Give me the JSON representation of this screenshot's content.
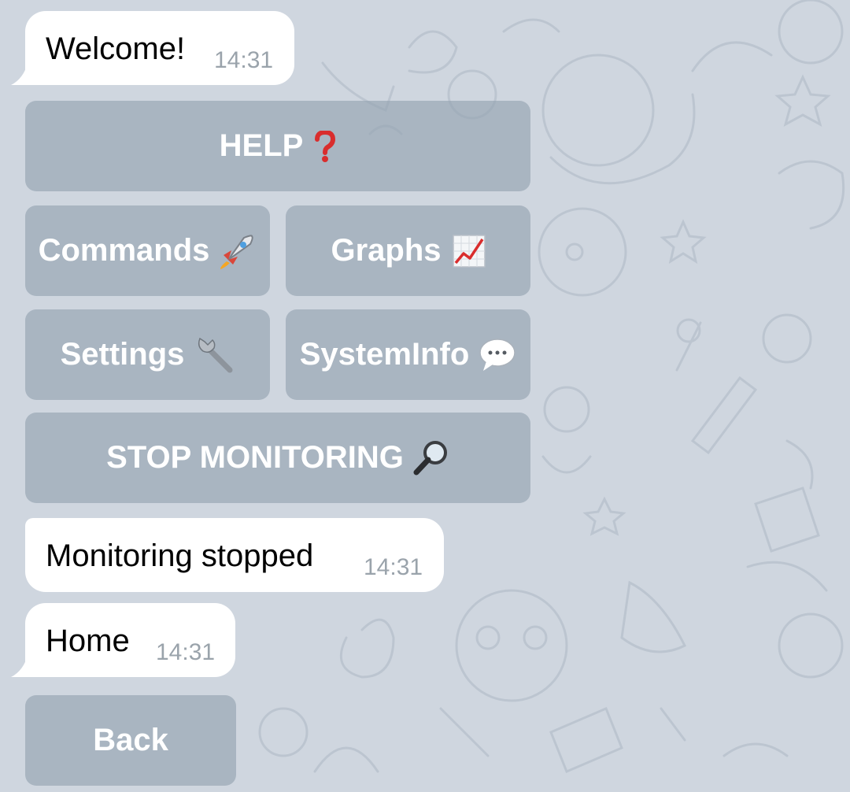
{
  "colors": {
    "background": "#cfd6df",
    "bubble": "#ffffff",
    "button": "#a6b1bb",
    "timestamp": "#9aa3ab"
  },
  "messages": [
    {
      "text": "Welcome!",
      "time": "14:31"
    },
    {
      "text": "Monitoring stopped",
      "time": "14:31"
    },
    {
      "text": "Home",
      "time": "14:31"
    }
  ],
  "keyboard_main": {
    "help": {
      "label": "HELP",
      "icon": "red-question-mark-icon"
    },
    "commands": {
      "label": "Commands",
      "icon": "rocket-icon"
    },
    "graphs": {
      "label": "Graphs",
      "icon": "chart-increasing-icon"
    },
    "settings": {
      "label": "Settings",
      "icon": "wrench-icon"
    },
    "systeminfo": {
      "label": "SystemInfo",
      "icon": "speech-balloon-icon"
    },
    "stop_monitoring": {
      "label": "STOP MONITORING",
      "icon": "magnifying-glass-icon"
    }
  },
  "keyboard_home": {
    "back": {
      "label": "Back"
    }
  }
}
